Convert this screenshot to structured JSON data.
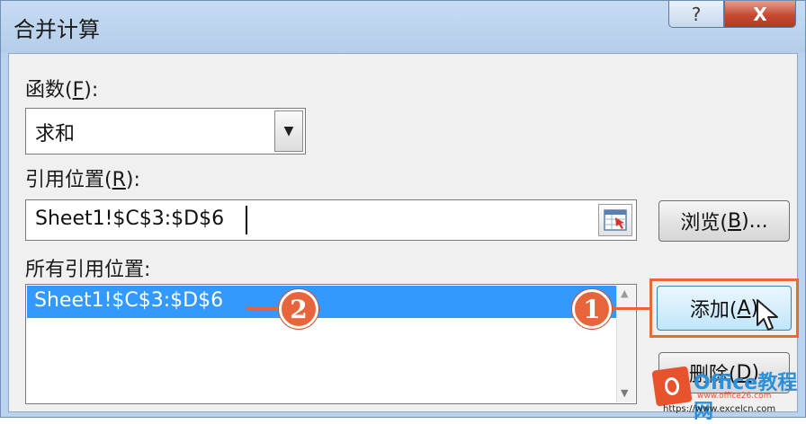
{
  "window": {
    "title": "合并计算",
    "help_label": "?",
    "close_label": "X"
  },
  "function": {
    "label": "函数(",
    "accel": "F",
    "label_end": "):",
    "value": "求和"
  },
  "reference": {
    "label": "引用位置(",
    "accel": "R",
    "label_end": "):",
    "value": "Sheet1!$C$3:$D$6",
    "browse_label": "浏览(",
    "browse_accel": "B",
    "browse_end": ")..."
  },
  "all_references": {
    "label": "所有引用位置:",
    "items": [
      "Sheet1!$C$3:$D$6"
    ]
  },
  "buttons": {
    "add_label": "添加(",
    "add_accel": "A",
    "add_end": ")",
    "delete_label": "删除(",
    "delete_accel": "D",
    "delete_end": ")"
  },
  "annotations": {
    "step1": "1",
    "step2": "2",
    "color": "#e8643a"
  },
  "watermark": {
    "title": "Office教程网",
    "url1": "www.office26.com",
    "url2": "https://www.excelcn.com"
  }
}
